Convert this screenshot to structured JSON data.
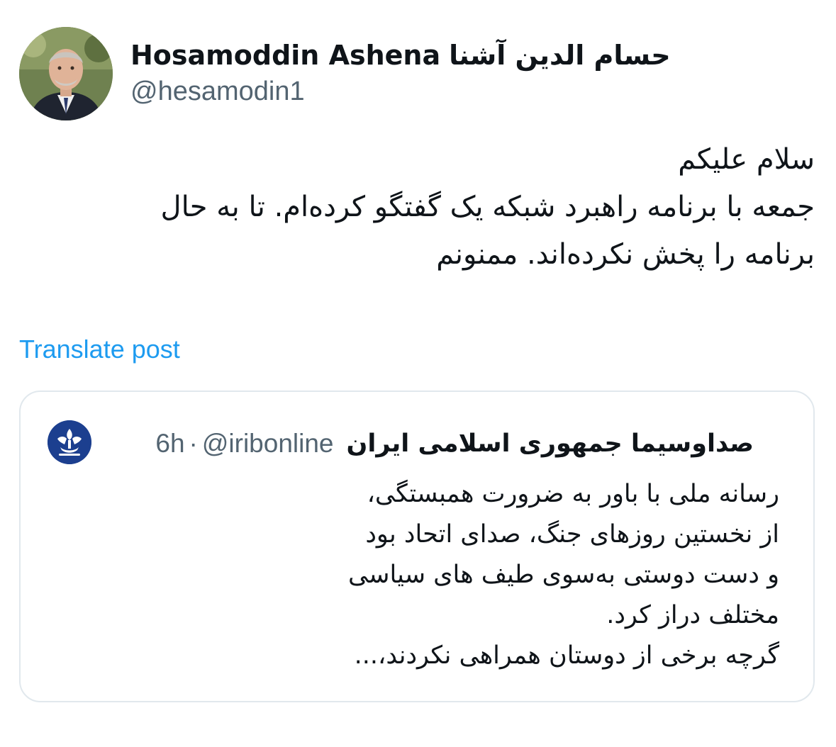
{
  "author": {
    "name_en": "Hosamoddin Ashena",
    "name_fa": "حسام الدین آشنا",
    "handle": "@hesamodin1",
    "avatar_icon": "profile-photo"
  },
  "tweet": {
    "lines": [
      "سلام علیکم",
      "جمعه با برنامه راهبرد شبکه یک گفتگو کرده‌ام. تا به حال",
      "برنامه را  پخش نکرده‌اند. ممنونم"
    ],
    "translate_label": "Translate post"
  },
  "quote": {
    "author_name": "صداوسیما جمهوری اسلامی ایران",
    "handle": "@iribonline",
    "separator": "·",
    "time": "6h",
    "avatar_icon": "irib-logo",
    "lines": [
      "رسانه ملی با باور به ضرورت همبستگی،",
      "از نخستین روزهای جنگ، صدای اتحاد بود",
      "و دست دوستی به‌سوی طیف های سیاسی",
      "مختلف دراز کرد.",
      "گرچه برخی از دوستان همراهی نکردند،..."
    ]
  },
  "colors": {
    "text": "#0f1419",
    "secondary": "#536471",
    "link": "#1d9bf0",
    "border": "#e1e8ed",
    "irib_blue": "#1c3f8f"
  }
}
